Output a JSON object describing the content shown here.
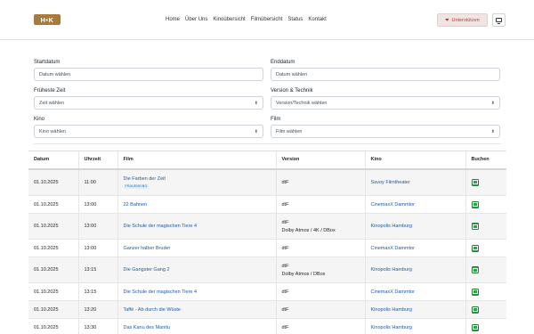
{
  "header": {
    "logo": "H•K",
    "nav": [
      "Home",
      "Über Uns",
      "Kinoübersicht",
      "Filmübersicht",
      "Status",
      "Kontakt"
    ],
    "support_label": "Unterstützen",
    "theme_icon": "monitor-icon"
  },
  "filters": {
    "startdatum": {
      "label": "Startdatum",
      "placeholder": "Datum wählen"
    },
    "enddatum": {
      "label": "Enddatum",
      "placeholder": "Datum wählen"
    },
    "frueheste_zeit": {
      "label": "Früheste Zeit",
      "placeholder": "Zeit wählen"
    },
    "version": {
      "label": "Version & Technik",
      "placeholder": "Version/Technik wählen"
    },
    "kino": {
      "label": "Kino",
      "placeholder": "Kino wählen"
    },
    "film": {
      "label": "Film",
      "placeholder": "Film wählen"
    }
  },
  "table": {
    "headers": [
      "Datum",
      "Uhrzeit",
      "Film",
      "Version",
      "Kino",
      "Buchen"
    ],
    "rows": [
      {
        "datum": "01.10.2025",
        "uhrzeit": "11:00",
        "film": "Die Farben der Zeit",
        "badge": "FRAUENKINO",
        "version": [
          "dtF"
        ],
        "kino": "Savoy Filmtheater"
      },
      {
        "datum": "01.10.2025",
        "uhrzeit": "13:00",
        "film": "22 Bahnen",
        "badge": "",
        "version": [
          "dtF"
        ],
        "kino": "CinemaxX Dammtor"
      },
      {
        "datum": "01.10.2025",
        "uhrzeit": "13:00",
        "film": "Die Schule der magischen Tiere 4",
        "badge": "",
        "version": [
          "dtF",
          "Dolby Atmos / 4K / DBox"
        ],
        "kino": "Kinopolis Hamburg"
      },
      {
        "datum": "01.10.2025",
        "uhrzeit": "13:00",
        "film": "Ganzer halber Bruder",
        "badge": "",
        "version": [
          "dtF"
        ],
        "kino": "CinemaxX Dammtor"
      },
      {
        "datum": "01.10.2025",
        "uhrzeit": "13:15",
        "film": "Die Gangster Gang 2",
        "badge": "",
        "version": [
          "dtF",
          "Dolby Atmos / DBox"
        ],
        "kino": "Kinopolis Hamburg"
      },
      {
        "datum": "01.10.2025",
        "uhrzeit": "13:15",
        "film": "Die Schule der magischen Tiere 4",
        "badge": "",
        "version": [
          "dtF"
        ],
        "kino": "CinemaxX Dammtor"
      },
      {
        "datum": "01.10.2025",
        "uhrzeit": "13:20",
        "film": "Taffé - Ab durch die Wüste",
        "badge": "",
        "version": [
          "dtF"
        ],
        "kino": "Kinopolis Hamburg"
      },
      {
        "datum": "01.10.2025",
        "uhrzeit": "13:30",
        "film": "Das Kanu des Manitu",
        "badge": "",
        "version": [
          "dtF"
        ],
        "kino": "Kinopolis Hamburg"
      }
    ]
  }
}
